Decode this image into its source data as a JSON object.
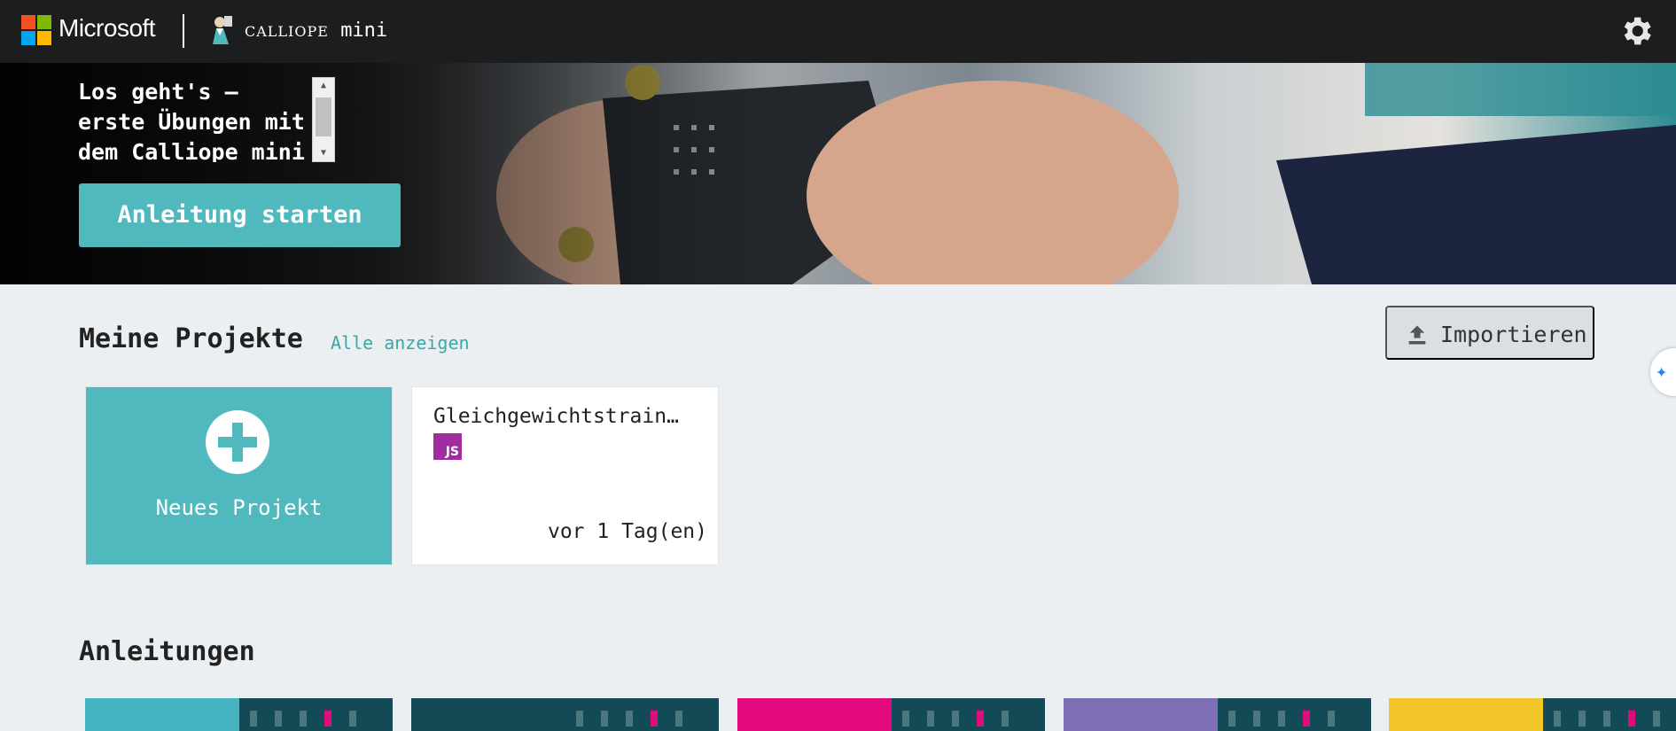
{
  "topbar": {
    "brand_ms": "Microsoft",
    "brand_name_small": "CALLIOPE",
    "brand_name": "mini",
    "settings_icon": "gear-icon",
    "ms_colors": [
      "#f25022",
      "#7fba00",
      "#00a4ef",
      "#ffb900"
    ]
  },
  "hero": {
    "title": "Los geht's – erste Übungen mit dem Calliope mini",
    "button_label": "Anleitung starten"
  },
  "projects": {
    "title": "Meine Projekte",
    "see_all": "Alle anzeigen",
    "import_label": "Importieren",
    "new_project_label": "Neues Projekt",
    "items": [
      {
        "name": "Gleichgewichtstrain…",
        "badge": "JS",
        "time": "vor 1 Tag(en)"
      }
    ]
  },
  "tutorials": {
    "title": "Anleitungen",
    "cards": [
      {
        "left": "#47b4c2",
        "right": "#124a55"
      },
      {
        "left": "#124a55",
        "right": "#124a55"
      },
      {
        "left": "#e3097f",
        "right": "#124a55"
      },
      {
        "left": "#7e6fb4",
        "right": "#124a55"
      },
      {
        "left": "#f2c52b",
        "right": "#124a55"
      }
    ]
  },
  "colors": {
    "accent": "#4fb9bd",
    "link": "#3ba8a7",
    "topbar": "#1b1d1f",
    "background": "#ebeff1",
    "js_badge": "#a12ea0"
  }
}
